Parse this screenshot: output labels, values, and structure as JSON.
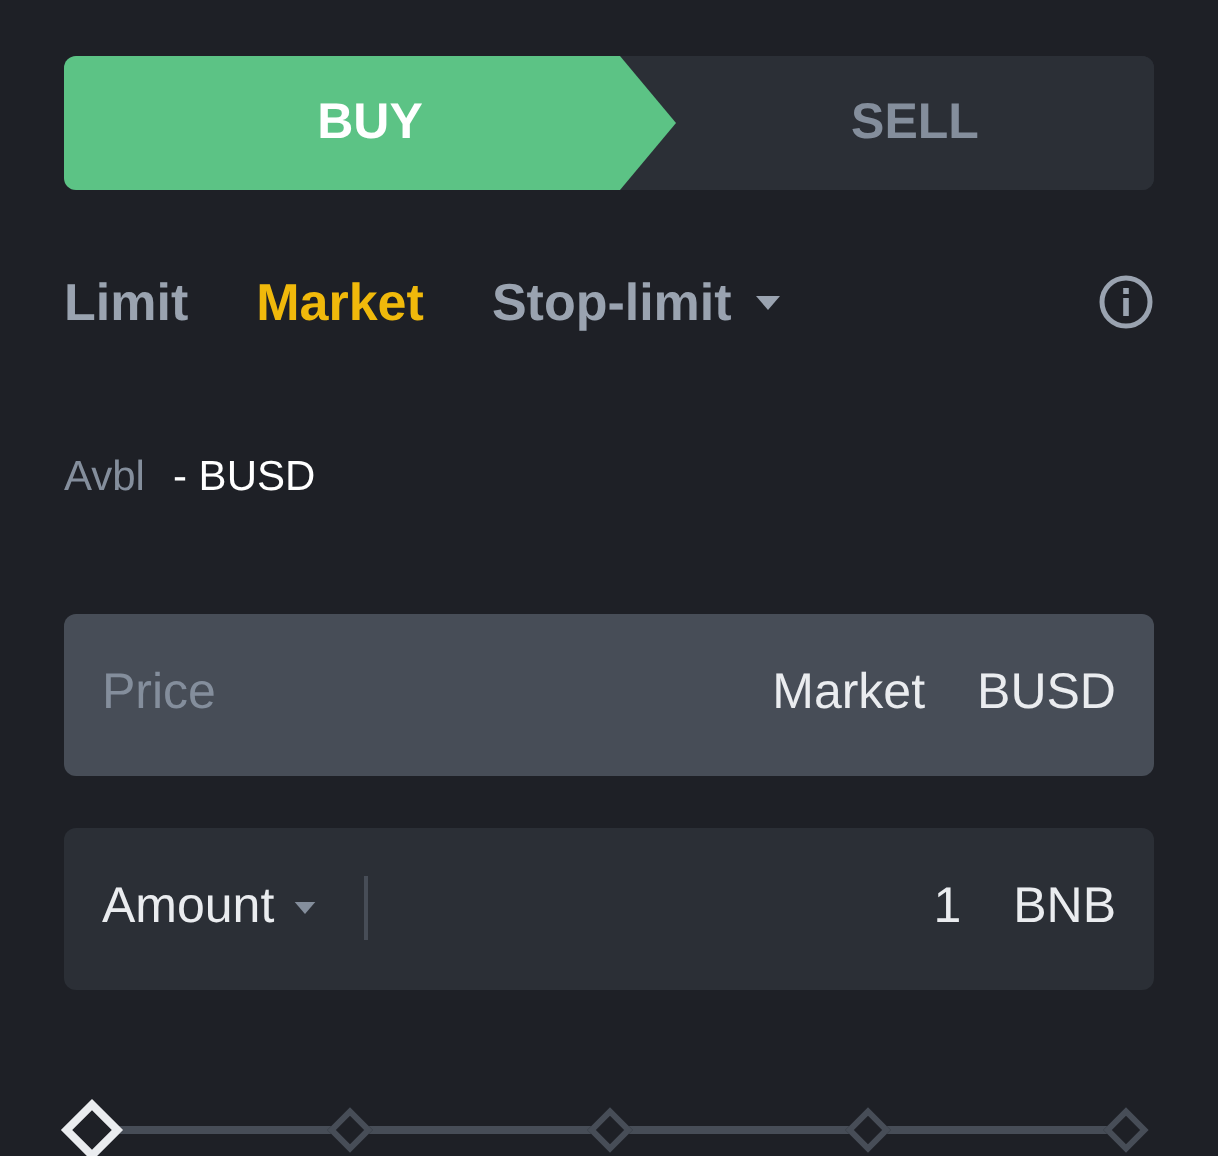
{
  "tabs": [
    {
      "label": "BUY",
      "selected": true
    },
    {
      "label": "SELL",
      "selected": false
    }
  ],
  "order_types": [
    {
      "label": "Limit",
      "selected": false,
      "kind": "plain"
    },
    {
      "label": "Market",
      "selected": true,
      "kind": "plain"
    },
    {
      "label": "Stop-limit",
      "selected": false,
      "kind": "dropdown"
    }
  ],
  "available": {
    "label": "Avbl",
    "value": "- BUSD"
  },
  "price_field": {
    "placeholder": "Price",
    "mode": "Market",
    "unit": "BUSD"
  },
  "amount_field": {
    "label": "Amount",
    "value": "1",
    "unit": "BNB"
  },
  "slider": {
    "level": 0
  }
}
